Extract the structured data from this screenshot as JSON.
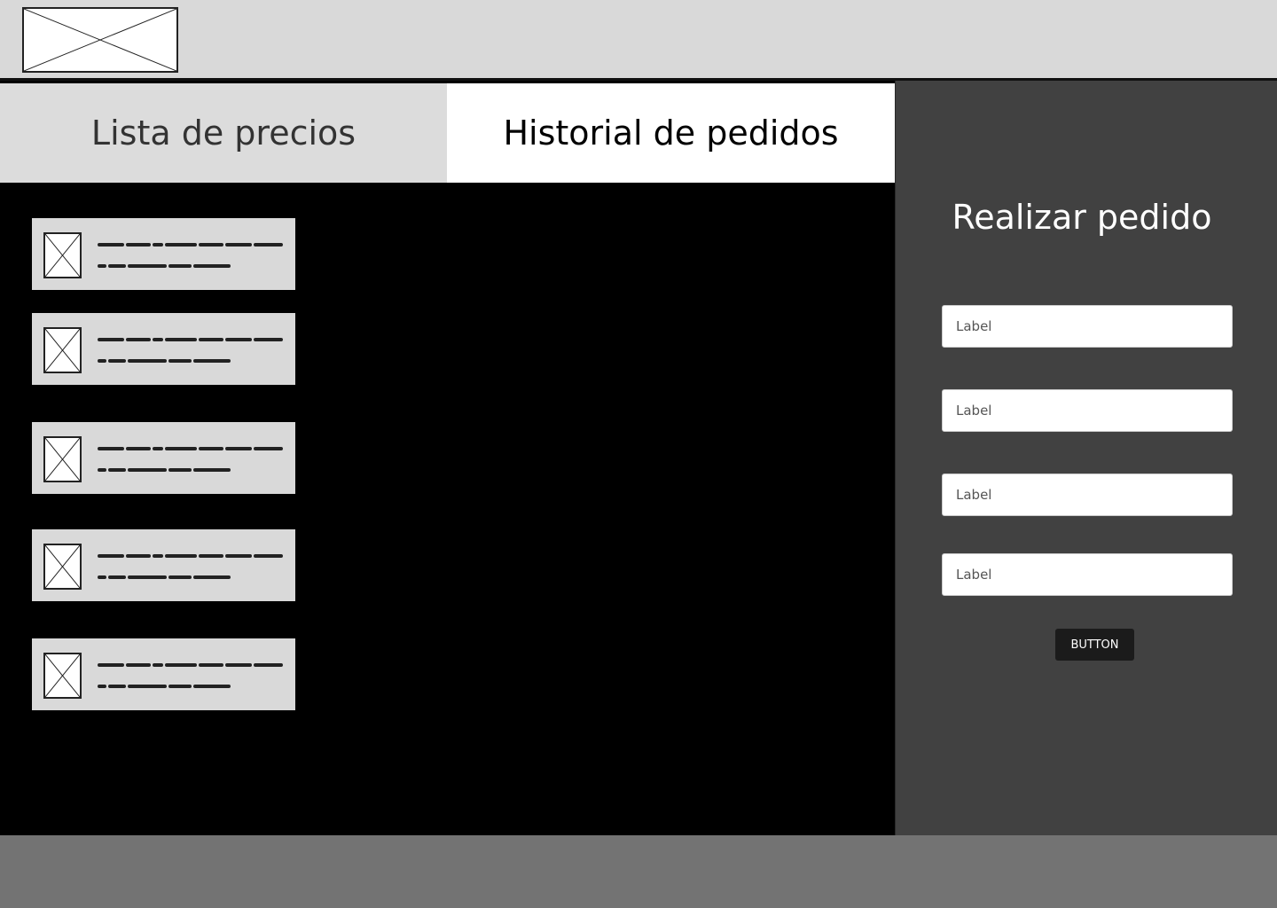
{
  "header": {
    "logo_icon": "image-placeholder-icon"
  },
  "tabs": [
    {
      "label": "Lista de precios"
    },
    {
      "label": "Historial de pedidos"
    }
  ],
  "product_list": {
    "items": [
      {
        "icon": "image-placeholder-icon"
      },
      {
        "icon": "image-placeholder-icon"
      },
      {
        "icon": "image-placeholder-icon"
      },
      {
        "icon": "image-placeholder-icon"
      },
      {
        "icon": "image-placeholder-icon"
      }
    ]
  },
  "order_panel": {
    "title": "Realizar pedido",
    "fields": [
      {
        "placeholder": "Label"
      },
      {
        "placeholder": "Label"
      },
      {
        "placeholder": "Label"
      },
      {
        "placeholder": "Label"
      }
    ],
    "button_label": "BUTTON"
  },
  "colors": {
    "header_bg": "#d9d9d9",
    "content_bg": "#000000",
    "side_panel_bg": "#414141",
    "footer_bg": "#737373",
    "button_bg": "#1b1b1b"
  }
}
